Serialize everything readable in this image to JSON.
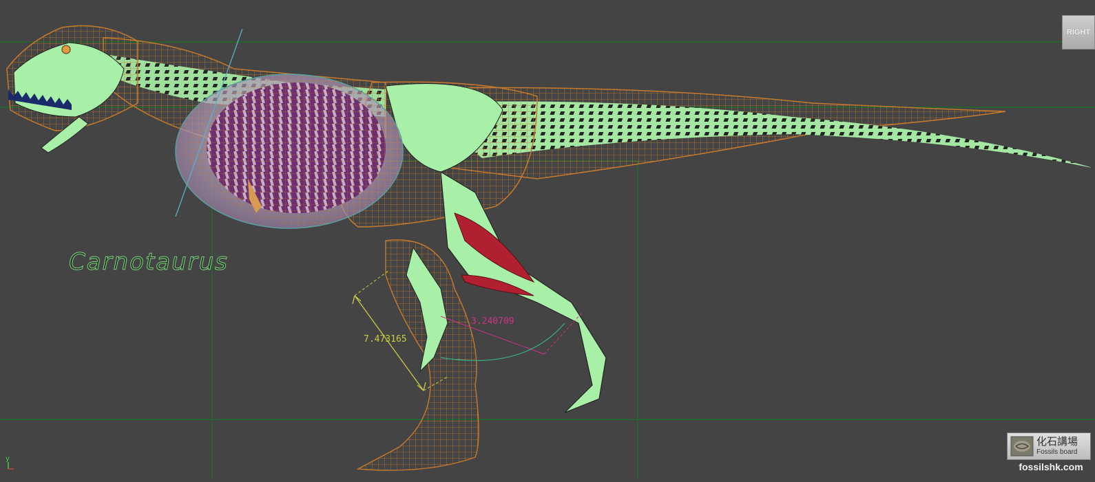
{
  "viewport": {
    "view_label": "RIGHT",
    "species_label": "Carnotaurus",
    "measure_length": "7.473165",
    "measure_angle": "3.240709",
    "axis_label": "y"
  },
  "watermark": {
    "title_cn": "化石講場",
    "title_en": "Fossils board",
    "url": "fossilshk.com"
  },
  "colors": {
    "background": "#444444",
    "grid": "#1f6b2a",
    "wireframe": "#c87a2c",
    "bone": "#a8f0a8",
    "organ": "#6a2a6a",
    "muscle": "#b02030",
    "measure": "#cccc44",
    "angle": "#cc3388"
  }
}
